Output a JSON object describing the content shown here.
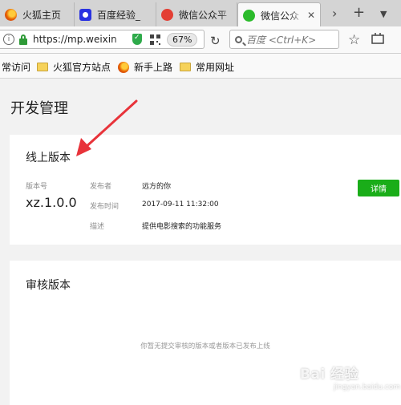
{
  "browser": {
    "tabs": [
      {
        "label": "火狐主页",
        "icon": "firefox-icon"
      },
      {
        "label": "百度经验_",
        "icon": "baidu-icon"
      },
      {
        "label": "微信公众平",
        "icon": "sogou-icon"
      },
      {
        "label": "微信公众",
        "icon": "wechat-icon",
        "active": true
      }
    ],
    "url": "https://mp.weixin",
    "zoom": "67%",
    "search_placeholder": "百度 <Ctrl+K>",
    "bookmarks": [
      "常访问",
      "火狐官方站点",
      "新手上路",
      "常用网址"
    ]
  },
  "page": {
    "title": "开发管理",
    "online": {
      "title": "线上版本",
      "version_label": "版本号",
      "version": "xz.1.0.0",
      "publisher_label": "发布者",
      "publisher": "远方的你",
      "time_label": "发布时间",
      "time": "2017-09-11 11:32:00",
      "desc_label": "描述",
      "desc": "提供电影搜索的功能服务",
      "detail_button": "详情"
    },
    "review": {
      "title": "审核版本",
      "empty_text": "你暂无提交审核的版本或者版本已发布上线"
    }
  },
  "watermark": {
    "text": "Bai 经验",
    "sub": "jingyan.baidu.com"
  },
  "colors": {
    "accent_green": "#1aad19",
    "arrow_red": "#e8333a"
  }
}
